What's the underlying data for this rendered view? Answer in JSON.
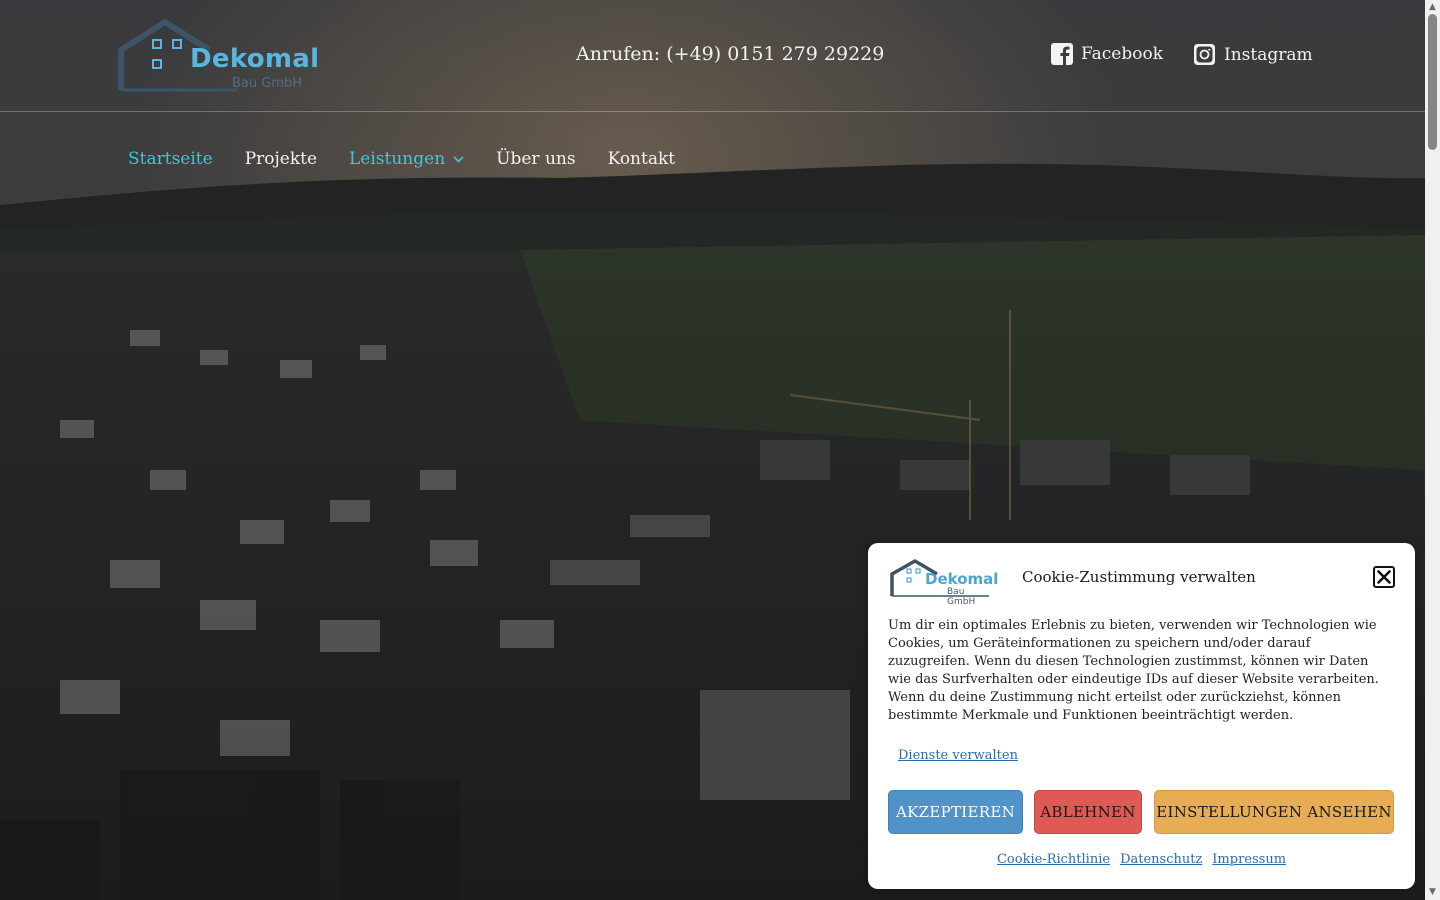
{
  "brand": {
    "name": "Dekomal",
    "subtitle": "Bau GmbH"
  },
  "header": {
    "phone": "Anrufen: (+49) 0151 279 29229",
    "social": [
      {
        "label": "Facebook",
        "icon": "facebook-icon"
      },
      {
        "label": "Instagram",
        "icon": "instagram-icon"
      }
    ]
  },
  "nav": {
    "items": [
      {
        "label": "Startseite",
        "active": true
      },
      {
        "label": "Projekte",
        "active": false
      },
      {
        "label": "Leistungen",
        "active": true,
        "has_dropdown": true
      },
      {
        "label": "Über uns",
        "active": false
      },
      {
        "label": "Kontakt",
        "active": false
      }
    ]
  },
  "cookie": {
    "title": "Cookie-Zustimmung verwalten",
    "text": "Um dir ein optimales Erlebnis zu bieten, verwenden wir Technologien wie Cookies, um Geräteinformationen zu speichern und/oder darauf zuzugreifen. Wenn du diesen Technologien zustimmst, können wir Daten wie das Surfverhalten oder eindeutige IDs auf dieser Website verarbeiten. Wenn du deine Zustimmung nicht erteilst oder zurückziehst, können bestimmte Merkmale und Funktionen beeinträchtigt werden.",
    "manage_link": "Dienste verwalten",
    "accept": "AKZEPTIEREN",
    "deny": "ABLEHNEN",
    "settings": "EINSTELLUNGEN ANSEHEN",
    "links": [
      "Cookie-Richtlinie",
      "Datenschutz",
      "Impressum"
    ]
  },
  "colors": {
    "accent": "#3cc8dc",
    "brand_blue": "#59b6e0",
    "accept": "#4f93c9",
    "deny": "#e05a55",
    "settings": "#e6ad55"
  }
}
